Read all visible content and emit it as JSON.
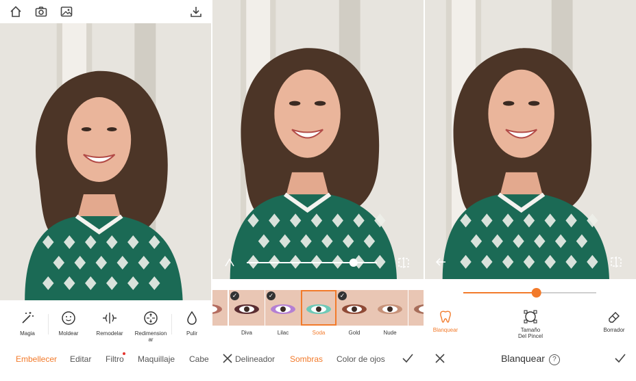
{
  "colors": {
    "accent": "#f27a2a",
    "text": "#333333",
    "muted": "#555555",
    "badge": "#e3342f"
  },
  "panel1": {
    "top_icons": [
      "home-icon",
      "camera-icon",
      "gallery-icon",
      "download-icon"
    ],
    "tools": [
      {
        "label": "Magia",
        "icon": "magic-wand-icon"
      },
      {
        "label": "Moldear",
        "icon": "face-icon"
      },
      {
        "label": "Remodelar",
        "icon": "reshape-icon"
      },
      {
        "label": "Redimension\nar",
        "icon": "resize-icon"
      },
      {
        "label": "Pulir",
        "icon": "drop-icon"
      }
    ],
    "tabs": [
      {
        "label": "Embellecer",
        "active": true
      },
      {
        "label": "Editar",
        "active": false
      },
      {
        "label": "Filtro",
        "active": false,
        "badge": true
      },
      {
        "label": "Maquillaje",
        "active": false
      },
      {
        "label": "Cabe",
        "active": false
      }
    ]
  },
  "panel2": {
    "slider": {
      "value": 0.82
    },
    "thumbs": [
      {
        "label": "ye",
        "checked": false,
        "selected": false
      },
      {
        "label": "Diva",
        "checked": true,
        "selected": false
      },
      {
        "label": "Lilac",
        "checked": true,
        "selected": false
      },
      {
        "label": "Soda",
        "checked": false,
        "selected": true
      },
      {
        "label": "Gold",
        "checked": true,
        "selected": false
      },
      {
        "label": "Nude",
        "checked": false,
        "selected": false
      },
      {
        "label": "C",
        "checked": false,
        "selected": false
      }
    ],
    "tabs": [
      {
        "label": "Delineador",
        "active": false
      },
      {
        "label": "Sombras",
        "active": true
      },
      {
        "label": "Color de ojos",
        "active": false
      }
    ]
  },
  "panel3": {
    "slider": {
      "value": 0.55
    },
    "tools": [
      {
        "label": "Blanquear",
        "icon": "tooth-icon",
        "active": true
      },
      {
        "label": "Tamaño\nDel Pincel",
        "icon": "brush-size-icon",
        "active": false
      },
      {
        "label": "Borrador",
        "icon": "eraser-icon",
        "active": false
      }
    ],
    "title": "Blanquear",
    "help": "?"
  }
}
